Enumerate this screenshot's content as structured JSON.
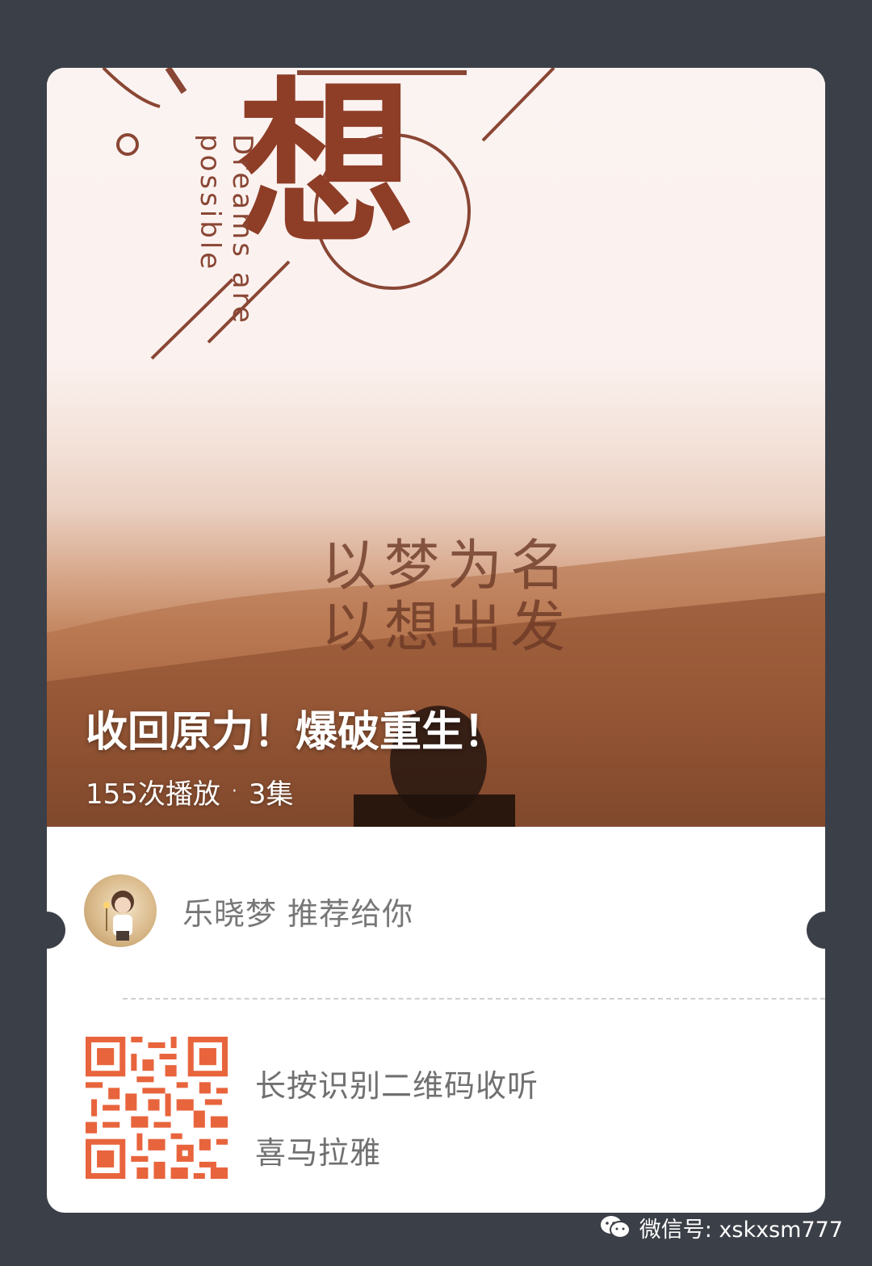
{
  "cover": {
    "big_char": "想",
    "en_line1": "Dreams are",
    "en_line2": "possible",
    "slogan_line1": "以梦为名",
    "slogan_line2": "以想出发",
    "title": "收回原力！爆破重生！",
    "plays": "155次播放",
    "separator": "·",
    "episodes": "3集"
  },
  "recommender": {
    "text": "乐晓梦 推荐给你"
  },
  "qr_section": {
    "instruction": "长按识别二维码收听",
    "brand": "喜马拉雅",
    "qr_color": "#e8643c"
  },
  "watermark": {
    "text": "微信号: xskxsm777"
  }
}
